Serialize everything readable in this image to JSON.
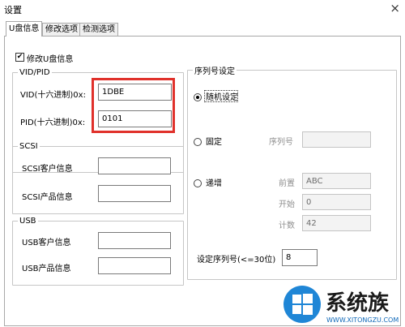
{
  "window": {
    "title": "设置",
    "close_glyph": "×"
  },
  "tabs": [
    {
      "label": "U盘信息",
      "active": true
    },
    {
      "label": "修改选项",
      "active": false
    },
    {
      "label": "检测选项",
      "active": false
    }
  ],
  "modify_checkbox": {
    "label": "修改U盘信息",
    "checked": true,
    "glyph": "✔"
  },
  "vidpid": {
    "legend": "VID/PID",
    "vid_label": "VID(十六进制)0x:",
    "vid_value": "1DBE",
    "pid_label": "PID(十六进制)0x:",
    "pid_value": "0101"
  },
  "scsi": {
    "legend": "SCSI",
    "vendor_label": "SCSI客户信息",
    "vendor_value": "",
    "product_label": "SCSI产品信息",
    "product_value": ""
  },
  "usb": {
    "legend": "USB",
    "vendor_label": "USB客户信息",
    "vendor_value": "",
    "product_label": "USB产品信息",
    "product_value": ""
  },
  "serial": {
    "legend": "序列号设定",
    "random_label": "随机设定",
    "fixed_label": "固定",
    "serial_label": "序列号",
    "serial_value": "",
    "increment_label": "递增",
    "prefix_label": "前置",
    "prefix_value": "ABC",
    "start_label": "开始",
    "start_value": "0",
    "count_label": "计数",
    "count_value": "42",
    "length_label": "设定序列号(<=30位)",
    "length_value": "8",
    "selected_option": "random"
  },
  "watermark": {
    "brand": "系统族",
    "url": "WWW.XITONGZU.COM"
  },
  "colors": {
    "highlight": "#e0312b",
    "logo_blue": "#1f86d6"
  }
}
